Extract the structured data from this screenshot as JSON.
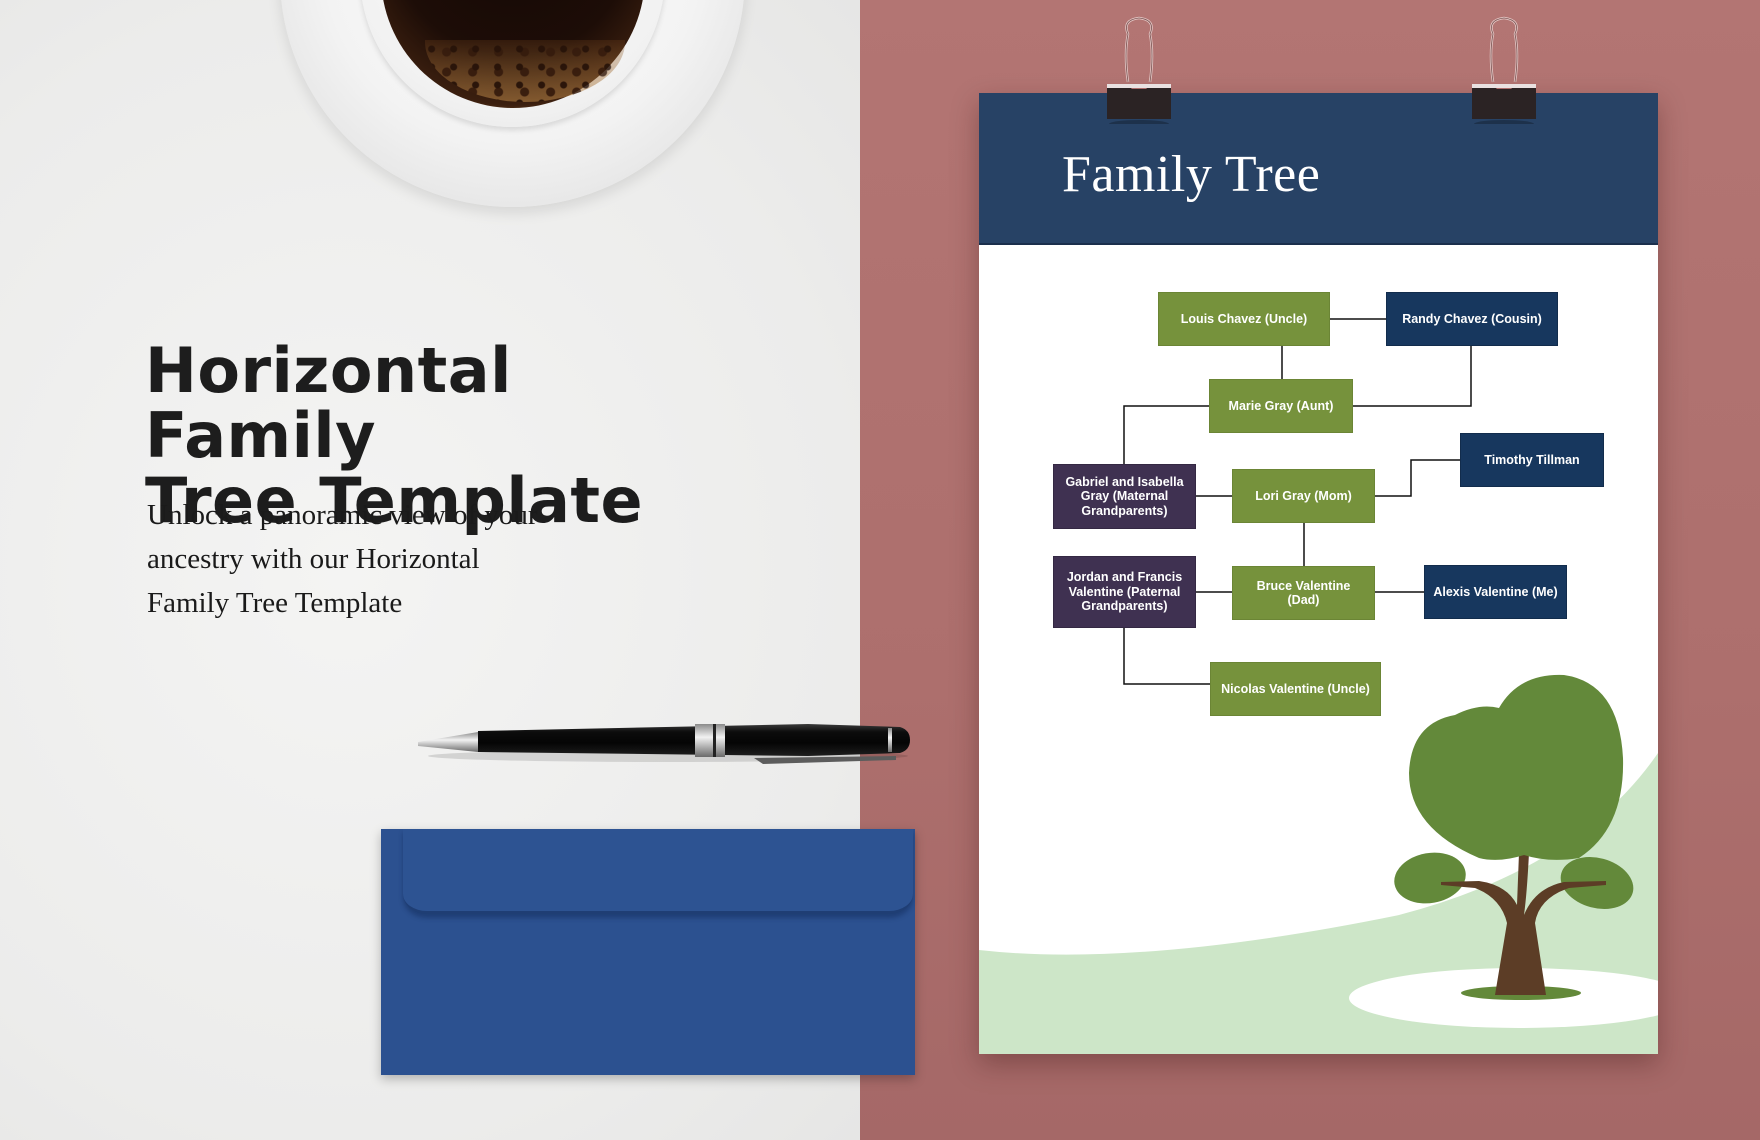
{
  "promo": {
    "headline_line1": "Horizontal Family",
    "headline_line2": "Tree Template",
    "subtitle_line1": "Unlock a panoramic view of your",
    "subtitle_line2": "ancestry with our Horizontal",
    "subtitle_line3": "Family Tree Template"
  },
  "colors": {
    "background_left": "#efefee",
    "background_right": "#ad6f6d",
    "paper_header": "#274265",
    "node_green": "#76923c",
    "node_navy": "#17375e",
    "node_purple": "#3f3151",
    "envelope": "#2c5190",
    "hill": "#cde6c8",
    "canopy": "#63893a",
    "trunk": "#5c3d26"
  },
  "paper": {
    "title": "Family Tree"
  },
  "family_tree": {
    "nodes": [
      {
        "id": "louis",
        "label": "Louis Chavez (Uncle)",
        "style": "green"
      },
      {
        "id": "randy",
        "label": "Randy Chavez (Cousin)",
        "style": "navy"
      },
      {
        "id": "marie",
        "label": "Marie Gray (Aunt)",
        "style": "green"
      },
      {
        "id": "timothy",
        "label": "Timothy Tillman",
        "style": "navy"
      },
      {
        "id": "gabriel",
        "label": "Gabriel and Isabella Gray (Maternal Grandparents)",
        "style": "purple"
      },
      {
        "id": "lori",
        "label": "Lori Gray (Mom)",
        "style": "green"
      },
      {
        "id": "jordan",
        "label": "Jordan and Francis Valentine (Paternal Grandparents)",
        "style": "purple"
      },
      {
        "id": "bruce",
        "label": "Bruce Valentine (Dad)",
        "style": "green"
      },
      {
        "id": "alexis",
        "label": "Alexis Valentine (Me)",
        "style": "navy"
      },
      {
        "id": "nicolas",
        "label": "Nicolas Valentine (Uncle)",
        "style": "green"
      }
    ],
    "edges": [
      [
        "louis",
        "randy"
      ],
      [
        "louis",
        "marie"
      ],
      [
        "randy",
        "marie"
      ],
      [
        "marie",
        "gabriel"
      ],
      [
        "gabriel",
        "lori"
      ],
      [
        "lori",
        "timothy"
      ],
      [
        "lori",
        "bruce"
      ],
      [
        "jordan",
        "bruce"
      ],
      [
        "bruce",
        "alexis"
      ],
      [
        "jordan",
        "nicolas"
      ]
    ]
  },
  "scene_objects": {
    "coffee": "coffee-cup-on-saucer",
    "pen": "black-ballpoint-pen",
    "envelope": "blue-envelope",
    "clips": "binder-clip"
  }
}
